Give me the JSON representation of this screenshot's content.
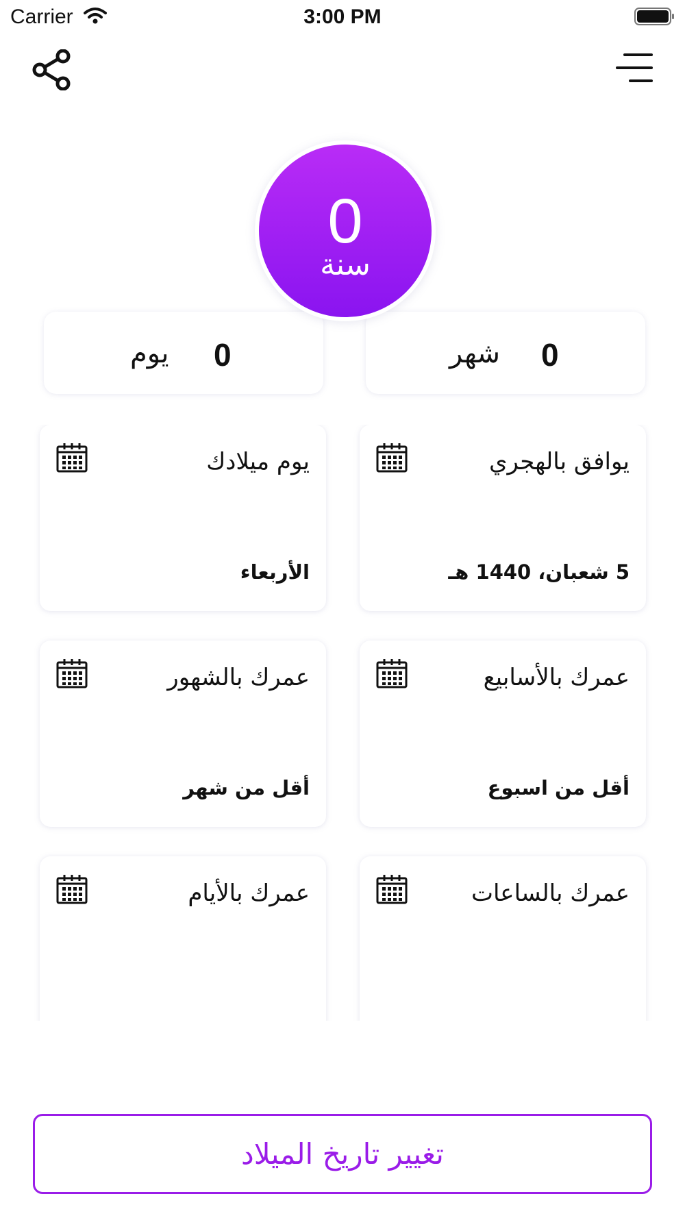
{
  "status_bar": {
    "carrier": "Carrier",
    "time": "3:00 PM"
  },
  "header": {
    "share_icon": "share-icon",
    "menu_icon": "menu-icon"
  },
  "age": {
    "years": "0",
    "years_label": "سنة"
  },
  "summary": {
    "months": {
      "value": "0",
      "label": "شهر"
    },
    "days": {
      "value": "0",
      "label": "يوم"
    }
  },
  "cards": [
    {
      "title": "يوافق بالهجري",
      "value": "5 شعبان، 1440 هـ",
      "icon": "calendar-icon"
    },
    {
      "title": "يوم ميلادك",
      "value": "الأربعاء",
      "icon": "calendar-icon"
    },
    {
      "title": "عمرك بالأسابيع",
      "value": "أقل من اسبوع",
      "icon": "calendar-icon"
    },
    {
      "title": "عمرك بالشهور",
      "value": "أقل من شهر",
      "icon": "calendar-icon"
    },
    {
      "title": "عمرك بالساعات",
      "value": "",
      "icon": "calendar-icon"
    },
    {
      "title": "عمرك بالأيام",
      "value": "",
      "icon": "calendar-icon"
    }
  ],
  "actions": {
    "change_birthdate": "تغيير تاريخ الميلاد"
  },
  "colors": {
    "accent": "#9a1ce8",
    "gradient_top": "#b92cf6",
    "gradient_bottom": "#8a14f0"
  }
}
